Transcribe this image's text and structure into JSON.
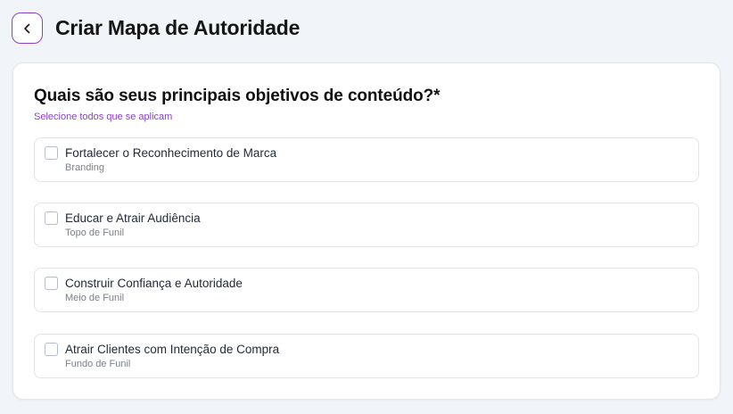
{
  "header": {
    "back_icon": "chevron-left-icon",
    "title": "Criar Mapa de Autoridade",
    "accent_color": "#8b3fd1"
  },
  "form": {
    "question": "Quais são seus principais objetivos de conteúdo?",
    "required_marker": "*",
    "subtitle": "Selecione todos que se aplicam",
    "options": [
      {
        "label": "Fortalecer o Reconhecimento de Marca",
        "sub": "Branding",
        "checked": false
      },
      {
        "label": "Educar e Atrair Audiência",
        "sub": "Topo de Funil",
        "checked": false
      },
      {
        "label": "Construir Confiança e Autoridade",
        "sub": "Meio de Funil",
        "checked": false
      },
      {
        "label": "Atrair Clientes com Intenção de Compra",
        "sub": "Fundo de Funil",
        "checked": false
      }
    ]
  }
}
